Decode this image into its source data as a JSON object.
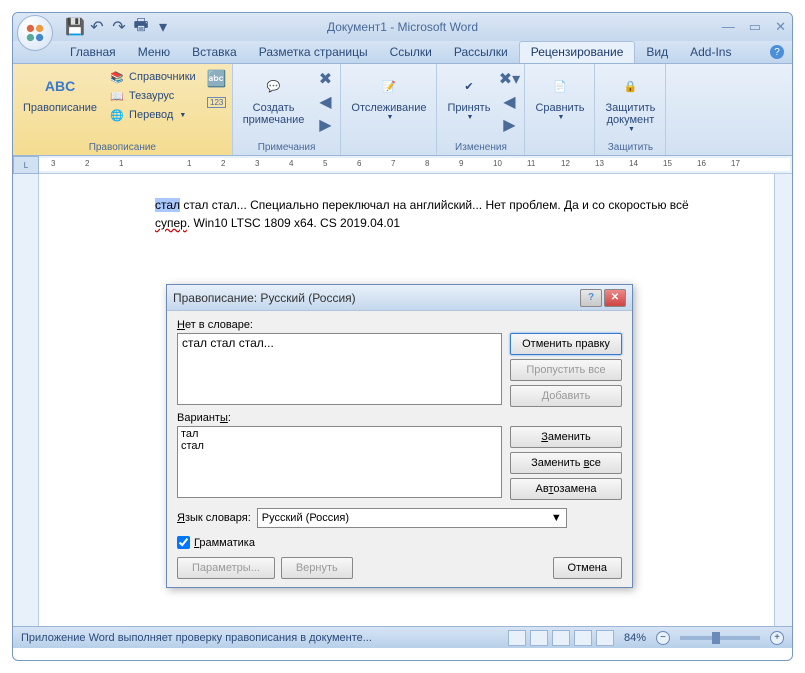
{
  "title": "Документ1 - Microsoft Word",
  "tabs": {
    "home": "Главная",
    "menu": "Меню",
    "insert": "Вставка",
    "layout": "Разметка страницы",
    "refs": "Ссылки",
    "mail": "Рассылки",
    "review": "Рецензирование",
    "view": "Вид",
    "addins": "Add-Ins"
  },
  "ribbon": {
    "spelling": "Правописание",
    "research": "Справочники",
    "thesaurus": "Тезаурус",
    "translate": "Перевод",
    "abc_icon": "ABC",
    "group_proofing": "Правописание",
    "comment": "Создать\nпримечание",
    "group_comments": "Примечания",
    "track": "Отслеживание",
    "accept": "Принять",
    "group_changes": "Изменения",
    "compare": "Сравнить",
    "protect": "Защитить\nдокумент",
    "group_protect": "Защитить"
  },
  "document": {
    "line1_highlight": "стал",
    "line1_rest": " стал стал... Специально переключал на английский... Нет проблем.  Да и со скоростью всё",
    "line2_red": "супер",
    "line2_rest": ". Win10 LTSC 1809 x64. CS 2019.04.01"
  },
  "dialog": {
    "title": "Правописание: Русский (Россия)",
    "not_in_dict": "Нет в словаре:",
    "text_content": "стал стал стал...",
    "undo_edit": "Отменить правку",
    "ignore_all": "Пропустить все",
    "add": "Добавить",
    "suggestions_label": "Варианты:",
    "suggestions": [
      "тал",
      "стал"
    ],
    "change": "Заменить",
    "change_all": "Заменить все",
    "autocorrect": "Автозамена",
    "lang_label": "Язык словаря:",
    "lang_value": "Русский (Россия)",
    "grammar_check": "Грамматика",
    "options": "Параметры...",
    "undo": "Вернуть",
    "cancel": "Отмена"
  },
  "status": {
    "text": "Приложение Word выполняет проверку правописания в документе...",
    "zoom": "84%"
  },
  "ruler": {
    "n3": "3",
    "n2": "2",
    "n1": "1",
    "p1": "1",
    "p2": "2",
    "p3": "3",
    "p4": "4",
    "p5": "5",
    "p6": "6",
    "p7": "7",
    "p8": "8",
    "p9": "9",
    "p10": "10",
    "p11": "11",
    "p12": "12",
    "p13": "13",
    "p14": "14",
    "p15": "15",
    "p16": "16",
    "p17": "17"
  }
}
